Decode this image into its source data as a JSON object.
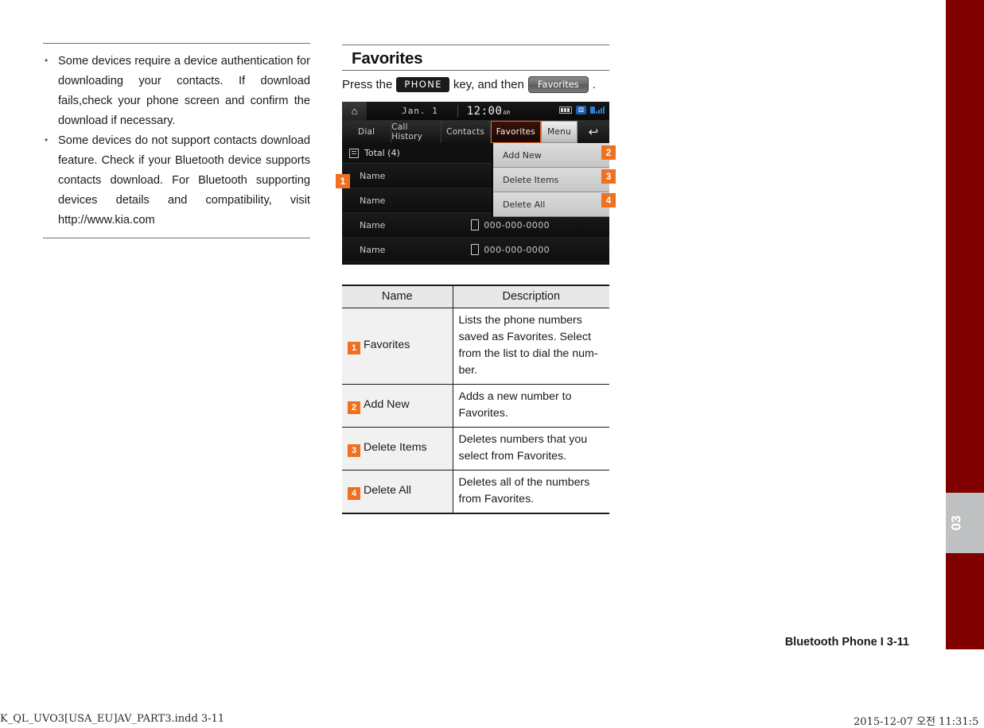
{
  "notes": {
    "items": [
      "Some devices require a device authentication for downloading your contacts. If download fails,check your phone screen and confirm the download if necessary.",
      "Some devices do not support contacts download feature. Check if your Bluetooth device supports contacts download. For Bluetooth supporting devices details and compatibility, visit http://www.kia.com"
    ]
  },
  "section": {
    "title": "Favorites",
    "press_prefix": "Press the",
    "key_phone": "PHONE",
    "press_middle": "key, and then",
    "key_favorites": "Favorites",
    "press_suffix": "."
  },
  "device": {
    "status": {
      "home_icon": "home-icon",
      "date": "Jan.  1",
      "time": "12:00",
      "ampm": "AM",
      "icons": [
        "battery-icon",
        "bluetooth-icon",
        "signal-icon"
      ]
    },
    "tabs": [
      {
        "label": "Dial",
        "state": "normal"
      },
      {
        "label": "Call History",
        "state": "normal"
      },
      {
        "label": "Contacts",
        "state": "normal"
      },
      {
        "label": "Favorites",
        "state": "active"
      },
      {
        "label": "Menu",
        "state": "menu"
      },
      {
        "label": "↩",
        "state": "back"
      }
    ],
    "total_label": "Total (4)",
    "rows": [
      {
        "name": "Name",
        "number": ""
      },
      {
        "name": "Name",
        "number": ""
      },
      {
        "name": "Name",
        "number": "000-000-0000"
      },
      {
        "name": "Name",
        "number": "000-000-0000"
      }
    ],
    "menu_items": [
      "Add New",
      "Delete Items",
      "Delete All"
    ],
    "badges": [
      "1",
      "2",
      "3",
      "4"
    ]
  },
  "table": {
    "headers": [
      "Name",
      "Description"
    ],
    "rows": [
      {
        "badge": "1",
        "name": "Favorites",
        "description": "Lists the phone numbers saved as Favorites. Select from the list to dial the num-ber."
      },
      {
        "badge": "2",
        "name": "Add New",
        "description": "Adds a new number to Favorites."
      },
      {
        "badge": "3",
        "name": "Delete Items",
        "description": "Deletes numbers that you select from Favorites."
      },
      {
        "badge": "4",
        "name": "Delete All",
        "description": "Deletes all of the numbers from Favorites."
      }
    ]
  },
  "footer": {
    "page_label": "Bluetooth Phone I 3-11",
    "chapter_tab": "03",
    "print_left": "K_QL_UVO3[USA_EU]AV_PART3.indd   3-11",
    "print_right": "2015-12-07   오전 11:31:5"
  },
  "colors": {
    "accent_orange": "#f0701f",
    "side_bar_red": "#800000",
    "tab_gray": "#bfc0c2"
  }
}
